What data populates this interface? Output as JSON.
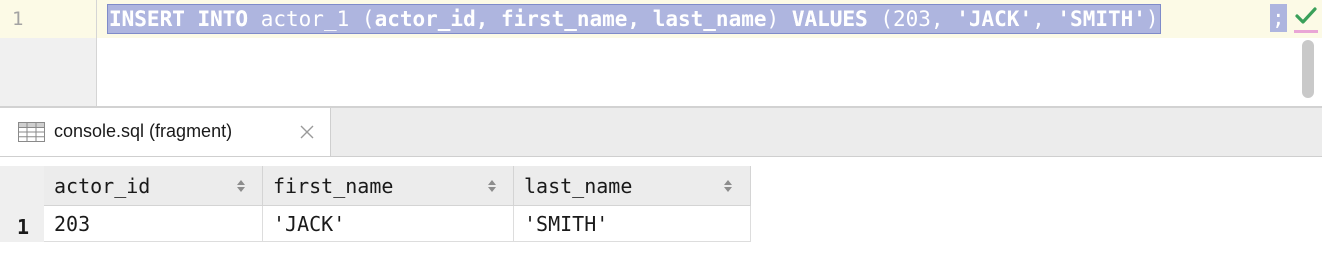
{
  "editor": {
    "line_number": "1",
    "sql": {
      "insert_kw": "INSERT INTO",
      "table_name": "actor_1",
      "open_paren": "(",
      "columns": "actor_id, first_name, last_name",
      "close_paren": ")",
      "values_kw": "VALUES",
      "values_open": "(",
      "v_id": "203",
      "sep1": ",",
      "v_first": "'JACK'",
      "sep2": ",",
      "v_last": "'SMITH'",
      "values_close": ")",
      "semicolon": ";"
    },
    "status_icon": "check-icon"
  },
  "tabs": [
    {
      "label": "console.sql (fragment)",
      "icon": "table-icon"
    }
  ],
  "result": {
    "columns": [
      "actor_id",
      "first_name",
      "last_name"
    ],
    "rows": [
      {
        "row_number": "1",
        "cells": [
          "203",
          "'JACK'",
          "'SMITH'"
        ]
      }
    ]
  },
  "colors": {
    "selection": "#aeb5df",
    "current_line": "#fcfae6",
    "check": "#3aa05a"
  }
}
